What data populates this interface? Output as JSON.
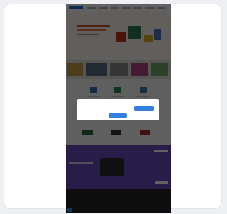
{
  "colors": {
    "background": "#eef0f4",
    "card": "#ffffff",
    "overlay": "rgba(0,0,0,0.62)",
    "accent": "#2f80e0",
    "promo": "#6b4bc0"
  },
  "screenshot": {
    "nav": {
      "logo_icon": "brand-logo"
    },
    "cookie_modal": {
      "title": "",
      "body": "",
      "accept_label": "",
      "settings_label": ""
    }
  }
}
